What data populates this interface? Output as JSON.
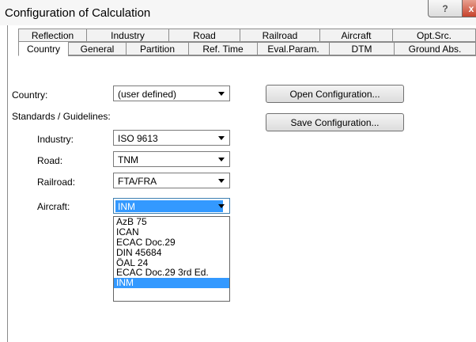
{
  "window": {
    "title": "Configuration of Calculation",
    "help_label": "?",
    "close_label": "x"
  },
  "tabs_back": [
    "Reflection",
    "Industry",
    "Road",
    "Railroad",
    "Aircraft",
    "Opt.Src."
  ],
  "tabs_front": [
    "Country",
    "General",
    "Partition",
    "Ref. Time",
    "Eval.Param.",
    "DTM",
    "Ground Abs."
  ],
  "active_tab": "Country",
  "form": {
    "country_label": "Country:",
    "country_value": "(user defined)",
    "standards_label": "Standards / Guidelines:",
    "industry_label": "Industry:",
    "industry_value": "ISO 9613",
    "road_label": "Road:",
    "road_value": "TNM",
    "railroad_label": "Railroad:",
    "railroad_value": "FTA/FRA",
    "aircraft_label": "Aircraft:",
    "aircraft_value": "INM"
  },
  "aircraft_options": [
    "AzB 75",
    "ICAN",
    "ECAC Doc.29",
    "DIN 45684",
    "ÖAL 24",
    "ECAC Doc.29 3rd Ed.",
    "INM"
  ],
  "aircraft_selected": "INM",
  "buttons": {
    "open_config": "Open Configuration...",
    "save_config": "Save Configuration..."
  }
}
